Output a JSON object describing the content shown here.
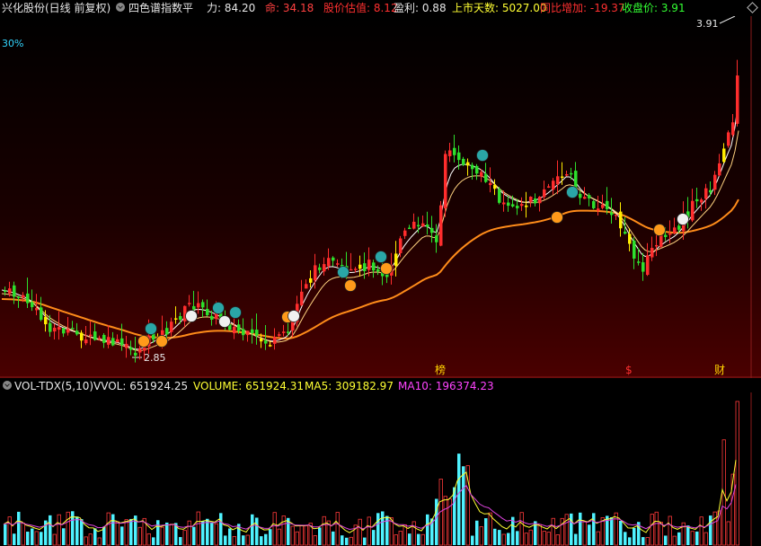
{
  "header": {
    "stock": "兴化股份(日线 前复权)",
    "indicator": "四色谱指数平",
    "items": [
      {
        "label": "力:",
        "value": "84.20",
        "color": "#e6e6e6"
      },
      {
        "label": "命:",
        "value": "34.18",
        "color": "#ff4040"
      },
      {
        "label": "股价估值:",
        "value": "8.12",
        "color": "#ff3030"
      },
      {
        "label": "盈利:",
        "value": "0.88",
        "color": "#e6e6e6"
      },
      {
        "label": "上市天数:",
        "value": "5027.00",
        "color": "#ffff33"
      },
      {
        "label": "同比增加:",
        "value": "-19.37",
        "color": "#ff3030"
      },
      {
        "label": "收盘价:",
        "value": "3.91",
        "color": "#33ff33"
      }
    ]
  },
  "main": {
    "pct_label": "30%",
    "high_label": "3.91",
    "low_label": "2.85",
    "markers": [
      "榜",
      "$",
      "财"
    ]
  },
  "volume_panel": {
    "name": "VOL-TDX(5,10)",
    "items": [
      {
        "label": "VVOL:",
        "value": "651924.25",
        "color": "#e6e6e6"
      },
      {
        "label": "VOLUME:",
        "value": "651924.31",
        "color": "#ffff33"
      },
      {
        "label": "MA5:",
        "value": "309182.97",
        "color": "#ffff33"
      },
      {
        "label": "MA10:",
        "value": "196374.23",
        "color": "#ff44ff"
      }
    ]
  },
  "colors": {
    "up": "#ff2d2d",
    "down": "#2ddf2d",
    "neutral": "#ffee00",
    "ma_long": "#ff8c1a",
    "ma_short": "#ffffff",
    "ma_mid": "#ffd27f",
    "vol_up": "#ff3a3a",
    "vol_down": "#4ff2ff",
    "vol_ma5": "#ffff33",
    "vol_ma10": "#dd44dd"
  },
  "chart_data": {
    "type": "candlestick",
    "price_range": [
      2.85,
      3.91
    ],
    "last_close": 3.91,
    "volume": {
      "last": 651924.31,
      "ma5": 309182.97,
      "ma10": 196374.23
    }
  }
}
